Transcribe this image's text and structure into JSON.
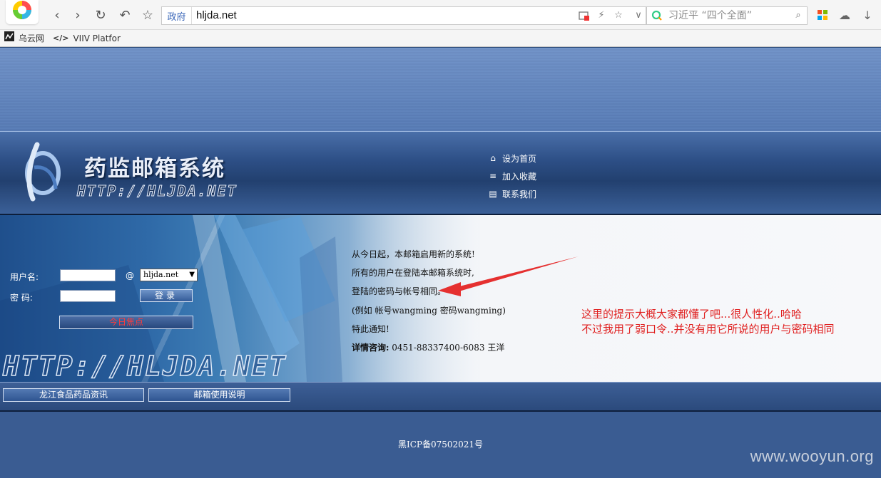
{
  "browser": {
    "address_tag": "政府",
    "url": "hljda.net",
    "search_placeholder": "习近平 “四个全面”",
    "bookmarks": [
      {
        "label": "乌云网"
      },
      {
        "label": "VIIV Platfor",
        "icon_text": "</>"
      }
    ]
  },
  "header": {
    "title": "药监邮箱系统",
    "url_banner": "HTTP://HLJDA.NET",
    "quick_links": [
      {
        "label": "设为首页",
        "icon": "home-icon"
      },
      {
        "label": "加入收藏",
        "icon": "cart-icon"
      },
      {
        "label": "联系我们",
        "icon": "document-icon"
      }
    ]
  },
  "login": {
    "username_label": "用户名:",
    "password_label": "密  码:",
    "at_sign": "@",
    "domain_selected": "hljda.net",
    "login_button": "登录",
    "focus_button": "今日焦点",
    "url_watermark": "HTTP://HLJDA.NET"
  },
  "notice": {
    "lines": [
      "从今日起，本邮箱启用新的系统!",
      "所有的用户在登陆本邮箱系统时,",
      "登陆的密码与帐号相同。",
      "(例如 帐号wangming 密码wangming)",
      "特此通知!"
    ],
    "contact_label": "详情咨询:",
    "contact_value": "0451-88337400-6083 王洋"
  },
  "annotation": {
    "lines": [
      "这里的提示大概大家都懂了吧...很人性化..哈哈",
      "不过我用了弱口令..并没有用它所说的用户与密码相同"
    ],
    "arrow_color": "#e53030"
  },
  "nav": {
    "tabs": [
      "龙江食品药品资讯",
      "邮箱使用说明"
    ]
  },
  "footer": {
    "icp": "黑ICP备07502021号",
    "watermark": "www.wooyun.org"
  }
}
